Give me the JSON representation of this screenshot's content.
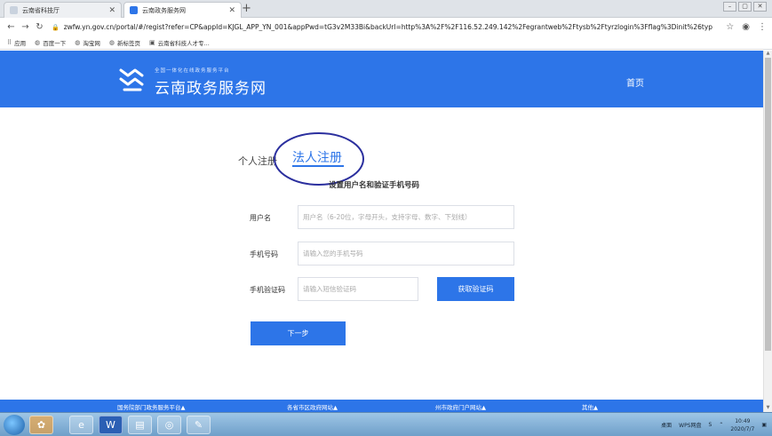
{
  "browser": {
    "tabs": [
      {
        "title": "云南省科技厅",
        "favicon_color": "#c9d2de"
      },
      {
        "title": "云南政务服务网",
        "favicon_color": "#2d75e8"
      }
    ],
    "url": "zwfw.yn.gov.cn/portal/#/regist?refer=CP&appId=KJGL_APP_YN_001&appPwd=tG3v2M33Bi&backUrl=http%3A%2F%2F116.52.249.142%2Fegrantweb%2Ftysb%2Ftyrzlogin%3Fflag%3Dinit%26type%3...",
    "bookmarks": [
      "应用",
      "百度一下",
      "淘宝网",
      "新标签页",
      "云南省科技人才专..."
    ]
  },
  "site": {
    "logo_small": "全国一体化在线政务服务平台",
    "logo_name": "云南政务服务网",
    "nav_home": "首页"
  },
  "register": {
    "tab_personal": "个人注册",
    "tab_corporate": "法人注册",
    "heading": "设置用户名和验证手机号码",
    "username_label": "用户名",
    "username_placeholder": "用户名（6-20位，字母开头，支持字母、数字、下划线）",
    "phone_label": "手机号码",
    "phone_placeholder": "请输入您的手机号码",
    "code_label": "手机验证码",
    "code_placeholder": "请输入短信验证码",
    "get_code_button": "获取验证码",
    "next_button": "下一步"
  },
  "footer": {
    "links": [
      "国务院部门政务服务平台▲",
      "各省市区政府网站▲",
      "州市政府门户网站▲",
      "其他▲"
    ]
  },
  "taskbar": {
    "apps": [
      "ie",
      "word",
      "file",
      "chrome",
      "paint"
    ],
    "tray_desktop": "桌面",
    "tray_wps": "WPS网盘",
    "time": "10:49",
    "date": "2020/7/7"
  },
  "colors": {
    "brand": "#2d75e8",
    "annotation": "#2b2f9e"
  }
}
